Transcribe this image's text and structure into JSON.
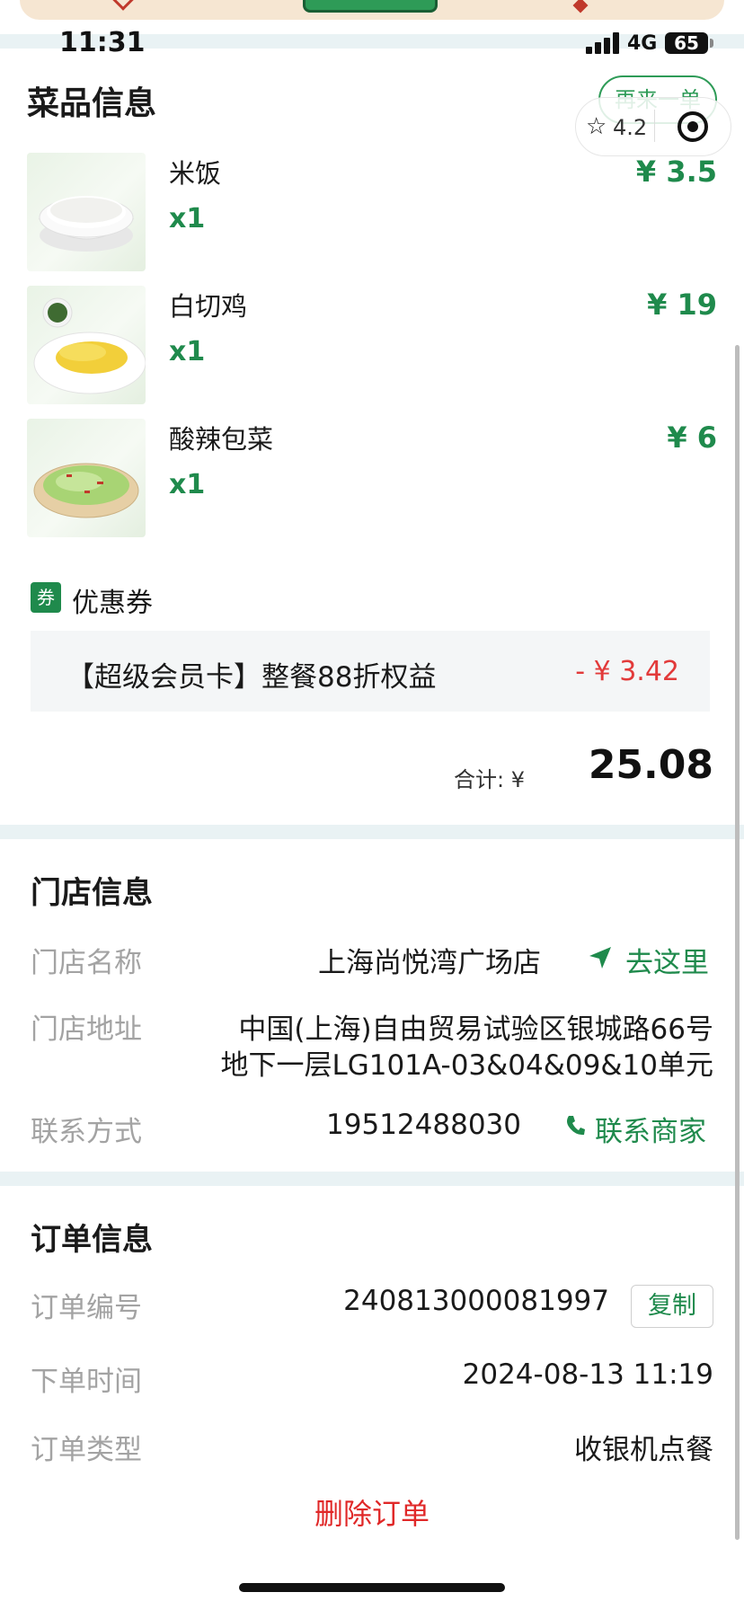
{
  "status_bar": {
    "time": "11:31",
    "network": "4G",
    "battery": "65"
  },
  "dishes": {
    "title": "菜品信息",
    "reorder_label": "再来一单",
    "rating": "4.2",
    "items": [
      {
        "name": "米饭",
        "qty": "x1",
        "price": "¥ 3.5"
      },
      {
        "name": "白切鸡",
        "qty": "x1",
        "price": "¥ 19"
      },
      {
        "name": "酸辣包菜",
        "qty": "x1",
        "price": "¥ 6"
      }
    ]
  },
  "coupon": {
    "badge": "券",
    "title": "优惠券",
    "name": "【超级会员卡】整餐88折权益",
    "amount": "- ¥ 3.42"
  },
  "total": {
    "label": "合计: ¥",
    "value": "25.08"
  },
  "store": {
    "title": "门店信息",
    "name_label": "门店名称",
    "name": "上海尚悦湾广场店",
    "navigate_label": "去这里",
    "address_label": "门店地址",
    "address_line1": "中国(上海)自由贸易试验区银城路66号",
    "address_line2": "地下一层LG101A-03&04&09&10单元",
    "contact_label": "联系方式",
    "phone": "19512488030",
    "contact_merchant_label": "联系商家"
  },
  "order": {
    "title": "订单信息",
    "number_label": "订单编号",
    "number": "240813000081997",
    "copy_label": "复制",
    "time_label": "下单时间",
    "time": "2024-08-13 11:19",
    "type_label": "订单类型",
    "type": "收银机点餐",
    "delete_label": "删除订单"
  },
  "colors": {
    "accent_green": "#1f8a4c",
    "danger_red": "#e02828",
    "muted_text": "#a3a3a3"
  }
}
